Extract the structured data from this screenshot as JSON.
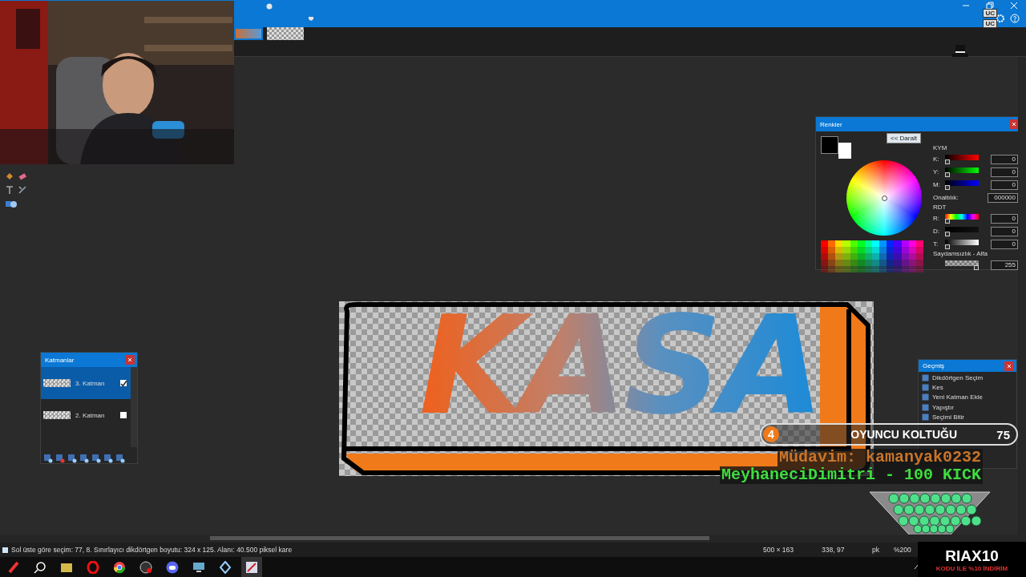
{
  "image_tabs": [
    {
      "selected": true
    },
    {
      "selected": false
    }
  ],
  "canvas": {
    "text": "KASA"
  },
  "colors_panel": {
    "title": "Renkler",
    "collapse_button": "<< Daralt",
    "kym_heading": "KYM",
    "kym": [
      {
        "label": "K:",
        "kind": "red",
        "level": 0,
        "value": "0"
      },
      {
        "label": "Y:",
        "kind": "green",
        "level": 0,
        "value": "0"
      },
      {
        "label": "M:",
        "kind": "blue",
        "level": 0,
        "value": "0"
      }
    ],
    "hex_label": "Onaltılık:",
    "hex_value": "000000",
    "rdt_heading": "RDT",
    "rdt": [
      {
        "label": "R:",
        "kind": "hue",
        "level": 0,
        "value": "0"
      },
      {
        "label": "D:",
        "kind": "saturation",
        "level": 0,
        "value": "0"
      },
      {
        "label": "T:",
        "kind": "brightness",
        "level": 0,
        "value": "0"
      }
    ],
    "alpha_heading": "Saydamsızlık - Alfa",
    "alpha": {
      "kind": "alpha",
      "level": 1,
      "value": "255"
    }
  },
  "layers_panel": {
    "title": "Katmanlar",
    "layers": [
      {
        "name": "3. Katman",
        "selected": true,
        "visible": true
      },
      {
        "name": "2. Katman",
        "selected": false,
        "visible": false
      }
    ]
  },
  "history_panel": {
    "title": "Geçmiş",
    "items": [
      "Dikdörtgen Seçim",
      "Kes",
      "Yeni Katman Ekle",
      "Yapıştır",
      "Seçimi Bitir"
    ]
  },
  "status_bar": {
    "message": "Sol üste göre seçim: 77, 8. Sınırlayıcı dikdörtgen boyutu: 324 x 125. Alanı: 40.500 piksel kare",
    "image_size": "500 × 163",
    "cursor_position": "338, 97",
    "unit": "pk",
    "zoom": "%200"
  },
  "overlay": {
    "badges": [
      "UC",
      "UC"
    ],
    "seat": {
      "number": "4",
      "label": "OYUNCU KOLTUĞU",
      "score": "75"
    },
    "chat": [
      "Müdavim: kamanyak0232",
      "MeyhaneciDimitri - 100 KICK"
    ],
    "sponsor": {
      "name": "RIAX10",
      "tagline": "KODU İLE %10 İNDİRİM"
    }
  }
}
